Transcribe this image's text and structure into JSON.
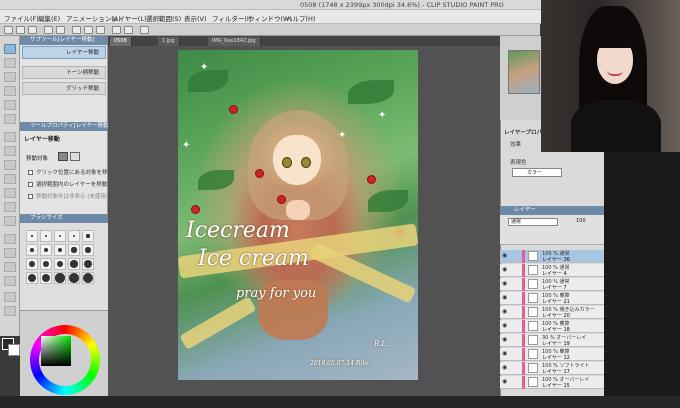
{
  "window": {
    "title": "0508 (1748 x 2399px 300dpi 34.6%) - CLIP STUDIO PAINT PRO"
  },
  "menu": {
    "items": [
      "ファイル(F)",
      "編集(E)",
      "アニメーション(A)",
      "レイヤー(L)",
      "選択範囲(S)",
      "表示(V)",
      "フィルター(I)",
      "ウィンドウ(W)",
      "ヘルプ(H)"
    ]
  },
  "tabs": [
    {
      "label": "0508"
    },
    {
      "label": "1.jpg"
    },
    {
      "label": "IMG_6ee1842.jpg"
    }
  ],
  "subtool": {
    "header": "サブツール[レイヤー移動]",
    "items": [
      {
        "label": "レイヤー移動"
      },
      {
        "label": "トーン柄移動"
      },
      {
        "label": "グリッド移動"
      }
    ],
    "prop_header": "ツールプロパティ[レイヤー移動]",
    "prop_title": "レイヤー移動",
    "move_target_label": "移動対象",
    "options": [
      "クリック位置にある対象を移動",
      "選択範囲内のレイヤーを移動",
      "移動対象外は非表示 (未使用)"
    ]
  },
  "brush_panel": {
    "header": "ブラシサイズ",
    "sizes": [
      1,
      2,
      3,
      4,
      5,
      6,
      7,
      8,
      9,
      10,
      11,
      12,
      13,
      14,
      15,
      16,
      17,
      18,
      19,
      20
    ]
  },
  "layer_prop": {
    "header": "レイヤープロパティ",
    "effect_label": "効果",
    "color_label": "表現色",
    "color_value": "カラー"
  },
  "layer_panel": {
    "header": "レイヤー",
    "blend": "通常",
    "opacity": "100",
    "rows": [
      {
        "line1": "100 % 通常",
        "line2": "レイヤー 36",
        "selected": true
      },
      {
        "line1": "100 % 通常",
        "line2": "レイヤー 4",
        "selected": false
      },
      {
        "line1": "100 % 通常",
        "line2": "レイヤー 7",
        "selected": false
      },
      {
        "line1": "100 % 乗算",
        "line2": "レイヤー 21",
        "selected": false
      },
      {
        "line1": "100 % 焼き込みカラー",
        "line2": "レイヤー 20",
        "selected": false
      },
      {
        "line1": "100 % 乗算",
        "line2": "レイヤー 18",
        "selected": false
      },
      {
        "line1": "30 % オーバーレイ",
        "line2": "レイヤー 19",
        "selected": false
      },
      {
        "line1": "100 % 乗算",
        "line2": "レイヤー 12",
        "selected": false
      },
      {
        "line1": "100 % ソフトライト",
        "line2": "レイヤー 17",
        "selected": false
      },
      {
        "line1": "100 % オーバーレイ",
        "line2": "レイヤー 15",
        "selected": false
      }
    ]
  },
  "artwork": {
    "text_line1": "Icecream",
    "text_line2": "Ice cream",
    "text_line3": "pray for you",
    "signature": "2018.05.07-14 Rilo",
    "signature_initial": "R.L."
  },
  "colors": {
    "accent": "#6f8aa6",
    "selected_layer": "#a8c6e2",
    "canvas_bg": "#525252"
  }
}
